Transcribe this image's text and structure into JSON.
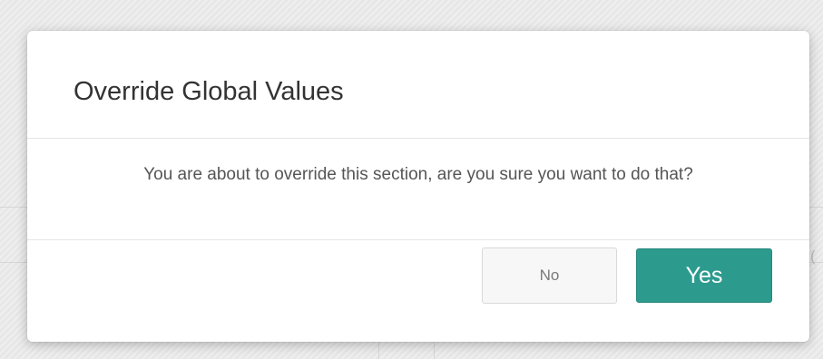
{
  "dialog": {
    "title": "Override Global Values",
    "message": "You are about to override this section, are you sure you want to do that?",
    "buttons": {
      "no_label": "No",
      "yes_label": "Yes"
    }
  },
  "background": {
    "partial_text": "("
  },
  "colors": {
    "primary_button": "#2c9b8e",
    "secondary_button": "#f7f7f7",
    "title_text": "#333333",
    "body_text": "#555555"
  }
}
